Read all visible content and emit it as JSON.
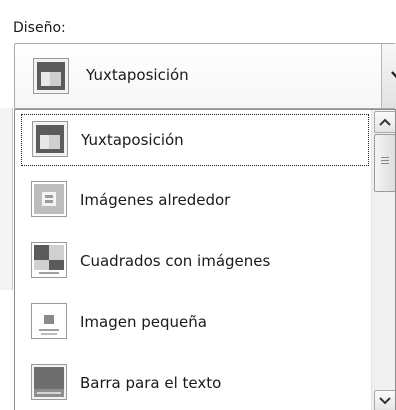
{
  "layout_field": {
    "label": "Diseño:",
    "selected": {
      "label": "Yuxtaposición",
      "icon": "layout-juxtaposition-icon"
    }
  },
  "options": [
    {
      "label": "Yuxtaposición",
      "icon": "layout-juxtaposition-icon"
    },
    {
      "label": "Imágenes alrededor",
      "icon": "layout-images-around-icon"
    },
    {
      "label": "Cuadrados con imágenes",
      "icon": "layout-squares-with-images-icon"
    },
    {
      "label": "Imagen pequeña",
      "icon": "layout-small-image-icon"
    },
    {
      "label": "Barra para el texto",
      "icon": "layout-text-bar-icon"
    }
  ],
  "colors": {
    "icon_dark": "#5b5b5b",
    "icon_light": "#d6d6d6",
    "border": "#8e8f8f"
  }
}
